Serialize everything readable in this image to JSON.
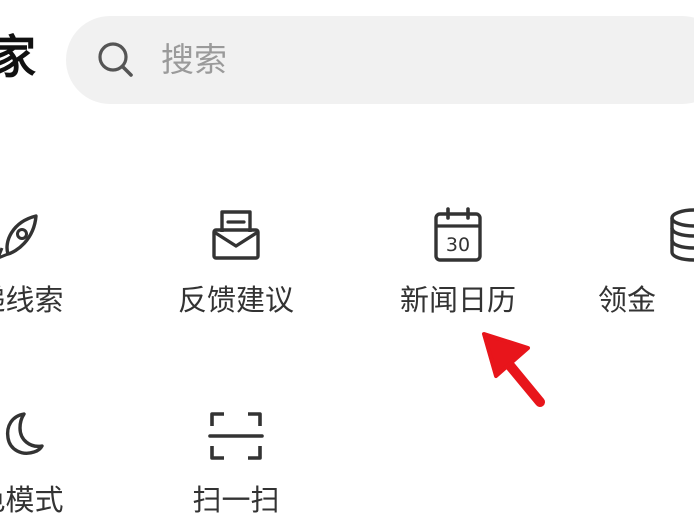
{
  "header": {
    "logo_text": "家"
  },
  "search": {
    "placeholder": "搜索",
    "icon": "search-icon"
  },
  "grid": {
    "row1": [
      {
        "label": "递线索",
        "icon": "rocket-icon"
      },
      {
        "label": "反馈建议",
        "icon": "feedback-mail-icon"
      },
      {
        "label": "新闻日历",
        "icon": "calendar-icon",
        "calendar_day": "30"
      },
      {
        "label": "领金",
        "icon": "coin-stack-icon"
      }
    ],
    "row2": [
      {
        "label": "色模式",
        "icon": "moon-icon"
      },
      {
        "label": "扫一扫",
        "icon": "scan-icon"
      }
    ]
  },
  "colors": {
    "icon": "#333333",
    "label": "#333333",
    "search_bg": "#f1f1f1",
    "placeholder": "#9a9a9a",
    "annotation_arrow": "#e8151b"
  }
}
